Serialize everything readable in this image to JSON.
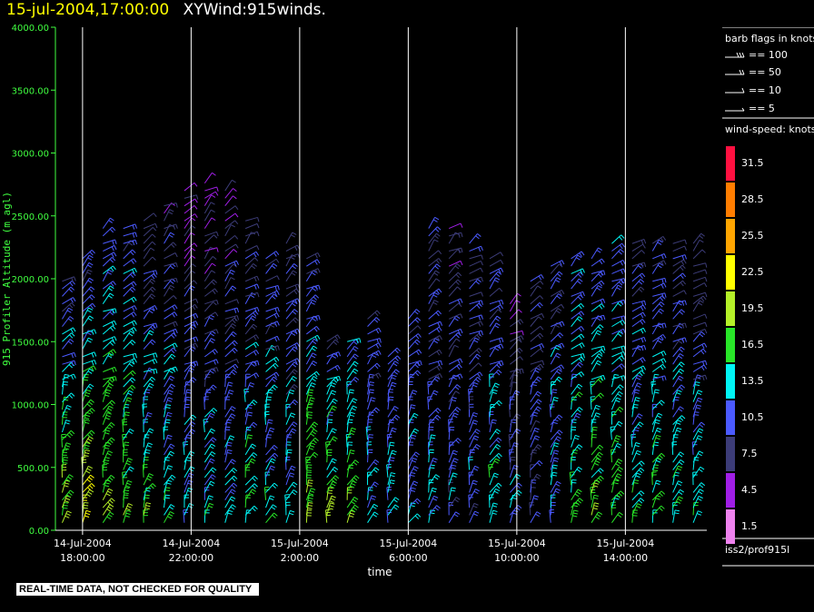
{
  "header": {
    "timestamp": "15-jul-2004,17:00:00",
    "product": "XYWind:915winds."
  },
  "legend": {
    "barb_title": "barb flags in knots",
    "barb_items": [
      "== 100",
      "== 50",
      "== 10",
      "== 5"
    ],
    "speed_title": "wind-speed: knots",
    "speed_bins": [
      {
        "label": "31.5",
        "color": "#ff1040"
      },
      {
        "label": "28.5",
        "color": "#ff7d00"
      },
      {
        "label": "25.5",
        "color": "#ffa500"
      },
      {
        "label": "22.5",
        "color": "#ffff00"
      },
      {
        "label": "19.5",
        "color": "#b4f028"
      },
      {
        "label": "16.5",
        "color": "#28e628"
      },
      {
        "label": "13.5",
        "color": "#00f5f5"
      },
      {
        "label": "10.5",
        "color": "#4b5aff"
      },
      {
        "label": "7.5",
        "color": "#3c3c78"
      },
      {
        "label": "4.5",
        "color": "#a01ee6"
      },
      {
        "label": "1.5",
        "color": "#ee82ee"
      }
    ],
    "source": "iss2/prof915l"
  },
  "footer": {
    "qc_note": "REAL-TIME DATA, NOT CHECKED FOR QUALITY"
  },
  "chart_data": {
    "type": "scatter",
    "title": "XYWind:915winds.",
    "xlabel": "time",
    "ylabel": "915 Profiler Altitude (m agl)",
    "ylim": [
      0,
      4000
    ],
    "y_ticks": [
      "0.00",
      "500.00",
      "1000.00",
      "1500.00",
      "2000.00",
      "2500.00",
      "3000.00",
      "3500.00",
      "4000.00"
    ],
    "x_ticks": [
      {
        "line1": "14-Jul-2004",
        "line2": "18:00:00"
      },
      {
        "line1": "14-Jul-2004",
        "line2": "22:00:00"
      },
      {
        "line1": "15-Jul-2004",
        "line2": "2:00:00"
      },
      {
        "line1": "15-Jul-2004",
        "line2": "6:00:00"
      },
      {
        "line1": "15-Jul-2004",
        "line2": "10:00:00"
      },
      {
        "line1": "15-Jul-2004",
        "line2": "14:00:00"
      }
    ],
    "xlim": [
      "14-Jul-2004 17:00",
      "15-Jul-2004 17:00"
    ],
    "grid": "vertical lines at tick times",
    "axis_color": "#40ff40",
    "series": [
      {
        "x_times": [
          "17:15",
          "18:00",
          "18:45",
          "19:30",
          "20:15",
          "21:00",
          "21:45",
          "22:30",
          "23:15",
          "00:00",
          "00:45",
          "01:30",
          "02:15",
          "03:00",
          "03:45",
          "04:30",
          "05:15",
          "06:00",
          "06:45",
          "07:30",
          "08:15",
          "09:00",
          "09:45",
          "10:30",
          "11:15",
          "12:00",
          "12:45",
          "13:30",
          "14:15",
          "15:00",
          "15:45",
          "16:30"
        ],
        "top_altitude_m": [
          2000,
          2200,
          2400,
          2400,
          2500,
          2600,
          2700,
          2800,
          2700,
          2500,
          2200,
          2300,
          2200,
          1500,
          1500,
          1700,
          1400,
          1700,
          2400,
          2400,
          2300,
          2200,
          1800,
          2000,
          2100,
          2200,
          2200,
          2300,
          2300,
          2300,
          2300,
          2300
        ],
        "low_speed_kt": [
          20,
          22,
          20,
          18,
          17,
          15,
          14,
          14,
          13,
          16,
          14,
          13,
          20,
          18,
          19,
          12,
          13,
          12,
          13,
          11,
          11,
          15,
          12,
          10,
          13,
          16,
          18,
          17,
          15,
          16,
          15,
          14
        ],
        "high_speed_kt": [
          9,
          9,
          10,
          10,
          8,
          7,
          5,
          5,
          6,
          7,
          9,
          8,
          8,
          10,
          11,
          10,
          10,
          9,
          8,
          7,
          8,
          8,
          6,
          8,
          9,
          10,
          10,
          10,
          9,
          9,
          8,
          7
        ]
      }
    ]
  }
}
